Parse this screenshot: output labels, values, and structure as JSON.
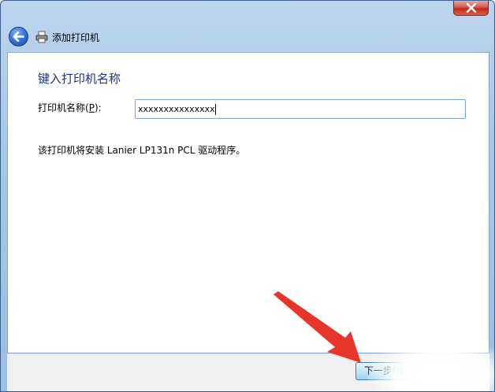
{
  "window": {
    "close_label": "close"
  },
  "navbar": {
    "title": "添加打印机"
  },
  "main": {
    "heading": "键入打印机名称",
    "field_label_prefix": "打印机名称(",
    "field_label_accel": "P",
    "field_label_suffix": "):",
    "printer_name_value": "xxxxxxxxxxxxxxx",
    "info_text": "该打印机将安装 Lanier LP131n PCL 驱动程序。"
  },
  "footer": {
    "next_label": "下一步(N)"
  },
  "annotation": {
    "arrow_color": "#e8352a"
  }
}
